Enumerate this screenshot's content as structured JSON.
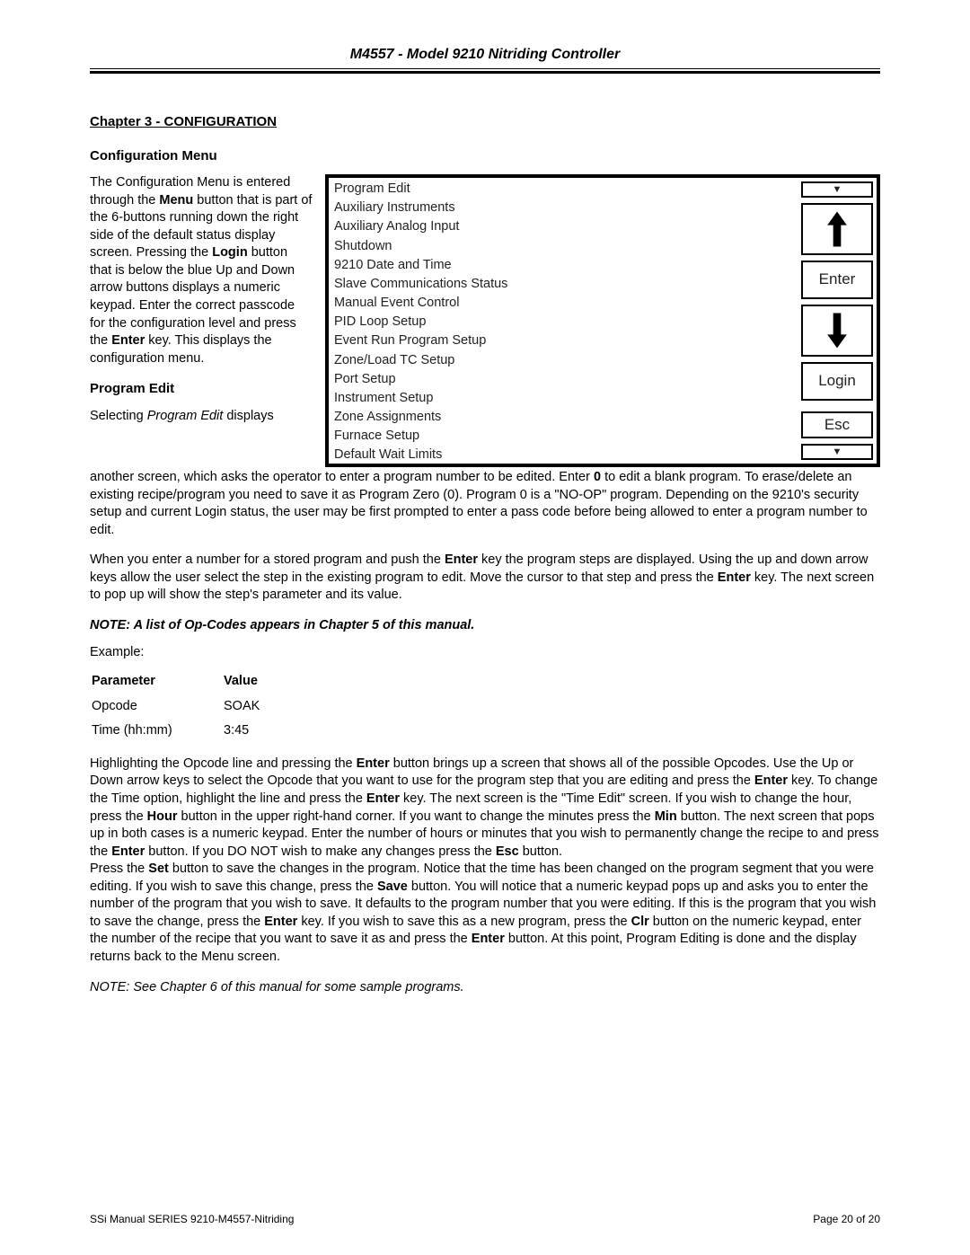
{
  "header": {
    "title": "M4557 - Model 9210 Nitriding Controller"
  },
  "chapter": {
    "title": "Chapter 3 - CONFIGURATION"
  },
  "config_menu": {
    "heading": "Configuration Menu",
    "para1_a": "The Configuration Menu is entered through the ",
    "para1_b": " button that is part of the 6-buttons running down the right side of the default status display screen. Pressing the ",
    "para1_c": " button that is below the blue Up and Down arrow buttons displays a numeric keypad. Enter the correct passcode for the configuration level and press the ",
    "para1_d": " key. This displays the configuration menu.",
    "bold_menu": "Menu",
    "bold_login": "Login",
    "bold_enter": "Enter"
  },
  "menu_items": [
    "Program Edit",
    "Auxiliary Instruments",
    "Auxiliary Analog Input",
    "Shutdown",
    "9210 Date and Time",
    "Slave Communications Status",
    "Manual Event Control",
    "PID Loop Setup",
    "Event Run Program Setup",
    "Zone/Load TC Setup",
    "Port Setup",
    "Instrument Setup",
    "Zone Assignments",
    "Furnace Setup",
    "Default Wait Limits"
  ],
  "side": {
    "enter": "Enter",
    "login": "Login",
    "esc": "Esc"
  },
  "program_edit": {
    "heading": "Program Edit",
    "sel_a": "Selecting ",
    "sel_b": "Program Edit",
    "sel_c": " displays another screen, which asks the operator to enter a program number to be edited. Enter ",
    "sel_d": "0",
    "sel_e": " to edit a blank program.  To erase/delete an existing recipe/program you need to save it as Program Zero (0).  Program 0 is a \"NO-OP\" program.   Depending on the 9210's security setup and current Login status, the user may be first prompted to enter a pass code before being allowed to enter a program number to edit.",
    "p2_a": "When you enter a number for a stored program and push the ",
    "p2_b": "Enter",
    "p2_c": " key the program steps are displayed. Using the up and down arrow keys allow the user select the step in the existing program to edit. Move the cursor to that step and press the ",
    "p2_d": "Enter",
    "p2_e": " key. The next screen to pop up will show the step's parameter and its value."
  },
  "note": "NOTE: A list of Op-Codes appears in Chapter 5 of this manual.",
  "example_label": "Example:",
  "table": {
    "h1": "Parameter",
    "h2": "Value",
    "r1c1": "Opcode",
    "r1c2": "SOAK",
    "r2c1": "Time (hh:mm)",
    "r2c2": "3:45"
  },
  "p3": {
    "a": "Highlighting the Opcode line and pressing the ",
    "b": "Enter",
    "c": " button brings up a screen that shows all of the possible Opcodes. Use the Up or Down arrow keys to select the Opcode that you want to use for the program step that you are editing and press the ",
    "d": "Enter",
    "e": " key.  To change the Time option, highlight the line and press the ",
    "f": "Enter",
    "g": " key. The next screen is the \"Time Edit\" screen. If you wish to change the hour, press the ",
    "h": "Hour",
    "i": " button in the upper right-hand corner. If you want to change the minutes press the ",
    "j": "Min",
    "k": " button. The next screen that pops up in both cases is a numeric keypad. Enter the number of hours or minutes that you wish to permanently change the recipe to and press the ",
    "l": "Enter",
    "m": " button. If you DO NOT wish to make any changes press the ",
    "n": "Esc",
    "o": " button."
  },
  "p4": {
    "a": "Press the ",
    "b": "Set",
    "c": " button to save the changes in the program.  Notice that the time has been changed on the program segment that you were editing. If you wish to save this change, press the ",
    "d": "Save",
    "e": " button. You will notice that a numeric keypad pops up and asks you to enter the number of the program that you wish to save. It defaults to the program number that you were editing. If this is the program that you wish to save the change, press the ",
    "f": "Enter",
    "g": " key. If you wish to save this as a new program, press the ",
    "h": "Clr",
    "i": " button on the numeric keypad, enter the number of the recipe that you want to save it as and press the ",
    "j": "Enter",
    "k": " button. At this point, Program Editing is done and the display returns back to the Menu screen."
  },
  "note2": "NOTE: See Chapter 6 of this manual for some sample programs.",
  "footer": {
    "left": "SSi Manual SERIES 9210-M4557-Nitriding",
    "right": "Page 20 of 20"
  }
}
